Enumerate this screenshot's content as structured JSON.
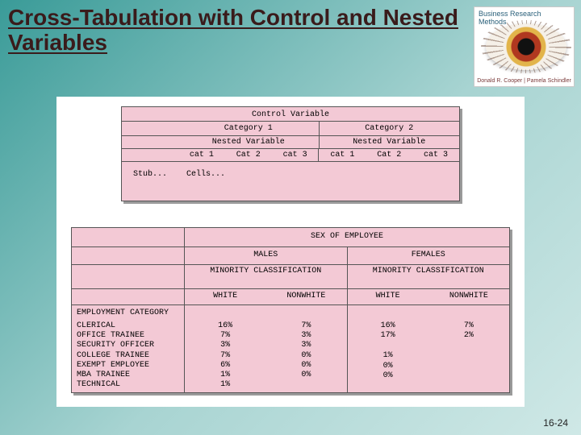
{
  "title": "Cross-Tabulation with Control and Nested Variables",
  "logo": {
    "brand": "Business Research Methods",
    "authors": "Donald R. Cooper  |  Pamela Schindler"
  },
  "schematic": {
    "control": "Control Variable",
    "cat1": "Category 1",
    "cat2": "Category 2",
    "nested": "Nested Variable",
    "c1": "cat 1",
    "c2": "Cat 2",
    "c3": "cat 3",
    "stub": "Stub...",
    "cells": "Cells..."
  },
  "table": {
    "controlHeader": "SEX OF EMPLOYEE",
    "groups": [
      "MALES",
      "FEMALES"
    ],
    "nestedHeader": "MINORITY CLASSIFICATION",
    "subcols": [
      "WHITE",
      "NONWHITE",
      "WHITE",
      "NONWHITE"
    ],
    "stubHeader": "EMPLOYMENT CATEGORY",
    "rows": [
      {
        "label": "CLERICAL",
        "vals": [
          "16%",
          "7%",
          "16%",
          "7%"
        ]
      },
      {
        "label": "OFFICE TRAINEE",
        "vals": [
          "7%",
          "3%",
          "17%",
          "2%"
        ]
      },
      {
        "label": "SECURITY OFFICER",
        "vals": [
          "3%",
          "3%",
          "",
          ""
        ]
      },
      {
        "label": "COLLEGE TRAINEE",
        "vals": [
          "7%",
          "0%",
          "1%",
          ""
        ]
      },
      {
        "label": "EXEMPT EMPLOYEE",
        "vals": [
          "6%",
          "0%",
          "0%",
          ""
        ]
      },
      {
        "label": "MBA TRAINEE",
        "vals": [
          "1%",
          "0%",
          "0%",
          ""
        ]
      },
      {
        "label": "TECHNICAL",
        "vals": [
          "1%",
          "",
          "",
          ""
        ]
      }
    ]
  },
  "pagenum": "16-24"
}
